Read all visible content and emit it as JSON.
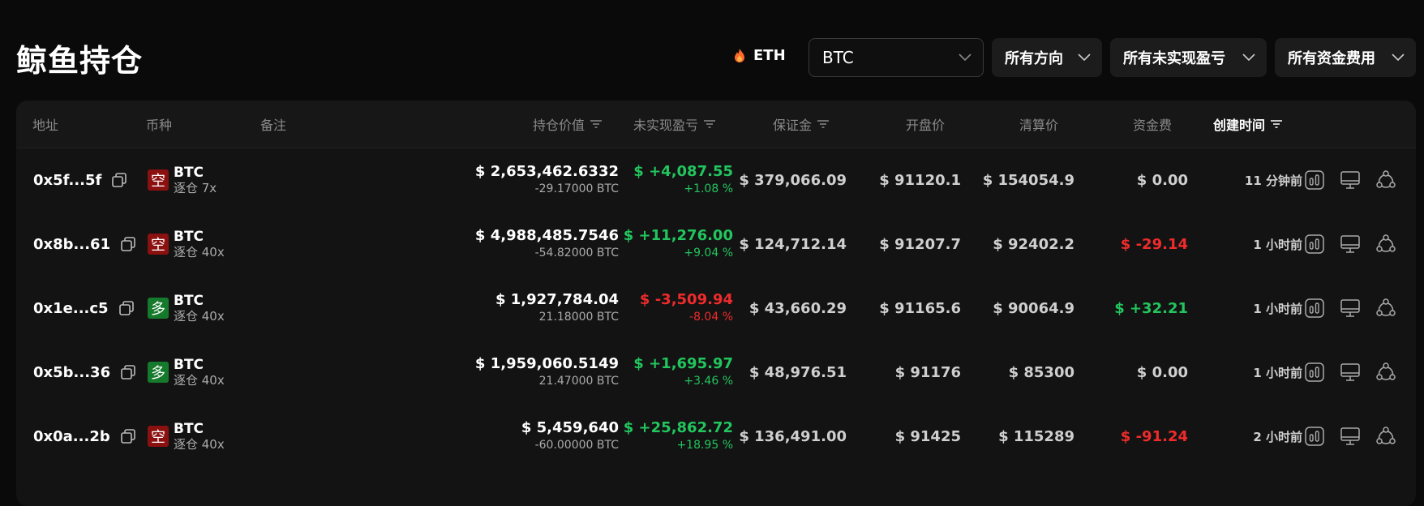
{
  "page": {
    "title": "鲸鱼持仓"
  },
  "filters": {
    "eth_label": "ETH",
    "coin_value": "BTC",
    "direction": "所有方向",
    "pnl": "所有未实现盈亏",
    "funding": "所有资金费用"
  },
  "headers": {
    "address": "地址",
    "coin": "币种",
    "note": "备注",
    "value": "持仓价值",
    "upnl": "未实现盈亏",
    "margin": "保证金",
    "entry": "开盘价",
    "liq": "清算价",
    "funding": "资金费",
    "created": "创建时间"
  },
  "rows": [
    {
      "address": "0x5f...5f",
      "side": "空",
      "side_type": "short",
      "coin": "BTC",
      "leverage": "逐仓 7x",
      "value": "$ 2,653,462.6332",
      "size": "-29.17000 BTC",
      "upnl": "$ +4,087.55",
      "upnl_pct": "+1.08 %",
      "upnl_sign": "pos",
      "margin": "$ 379,066.09",
      "entry": "$ 91120.1",
      "liq": "$ 154054.9",
      "funding": "$ 0.00",
      "funding_sign": "zero",
      "created": "11 分钟前"
    },
    {
      "address": "0x8b...61",
      "side": "空",
      "side_type": "short",
      "coin": "BTC",
      "leverage": "逐仓 40x",
      "value": "$ 4,988,485.7546",
      "size": "-54.82000 BTC",
      "upnl": "$ +11,276.00",
      "upnl_pct": "+9.04 %",
      "upnl_sign": "pos",
      "margin": "$ 124,712.14",
      "entry": "$ 91207.7",
      "liq": "$ 92402.2",
      "funding": "$ -29.14",
      "funding_sign": "neg",
      "created": "1 小时前"
    },
    {
      "address": "0x1e...c5",
      "side": "多",
      "side_type": "long",
      "coin": "BTC",
      "leverage": "逐仓 40x",
      "value": "$ 1,927,784.04",
      "size": "21.18000 BTC",
      "upnl": "$ -3,509.94",
      "upnl_pct": "-8.04 %",
      "upnl_sign": "neg",
      "margin": "$ 43,660.29",
      "entry": "$ 91165.6",
      "liq": "$ 90064.9",
      "funding": "$ +32.21",
      "funding_sign": "pos",
      "created": "1 小时前"
    },
    {
      "address": "0x5b...36",
      "side": "多",
      "side_type": "long",
      "coin": "BTC",
      "leverage": "逐仓 40x",
      "value": "$ 1,959,060.5149",
      "size": "21.47000 BTC",
      "upnl": "$ +1,695.97",
      "upnl_pct": "+3.46 %",
      "upnl_sign": "pos",
      "margin": "$ 48,976.51",
      "entry": "$ 91176",
      "liq": "$ 85300",
      "funding": "$ 0.00",
      "funding_sign": "zero",
      "created": "1 小时前"
    },
    {
      "address": "0x0a...2b",
      "side": "空",
      "side_type": "short",
      "coin": "BTC",
      "leverage": "逐仓 40x",
      "value": "$ 5,459,640",
      "size": "-60.00000 BTC",
      "upnl": "$ +25,862.72",
      "upnl_pct": "+18.95 %",
      "upnl_sign": "pos",
      "margin": "$ 136,491.00",
      "entry": "$ 91425",
      "liq": "$ 115289",
      "funding": "$ -91.24",
      "funding_sign": "neg",
      "created": "2 小时前"
    }
  ],
  "colors": {
    "positive": "#22c55e",
    "negative": "#ef2b2b",
    "short_badge": "#8b1010",
    "long_badge": "#167a2c"
  },
  "icons": {
    "eth": "flame-icon",
    "copy": "copy-icon",
    "chart": "chart-icon",
    "monitor": "monitor-icon",
    "share": "share-icon",
    "chevron": "chevron-down-icon",
    "filter": "sort-filter-icon"
  }
}
